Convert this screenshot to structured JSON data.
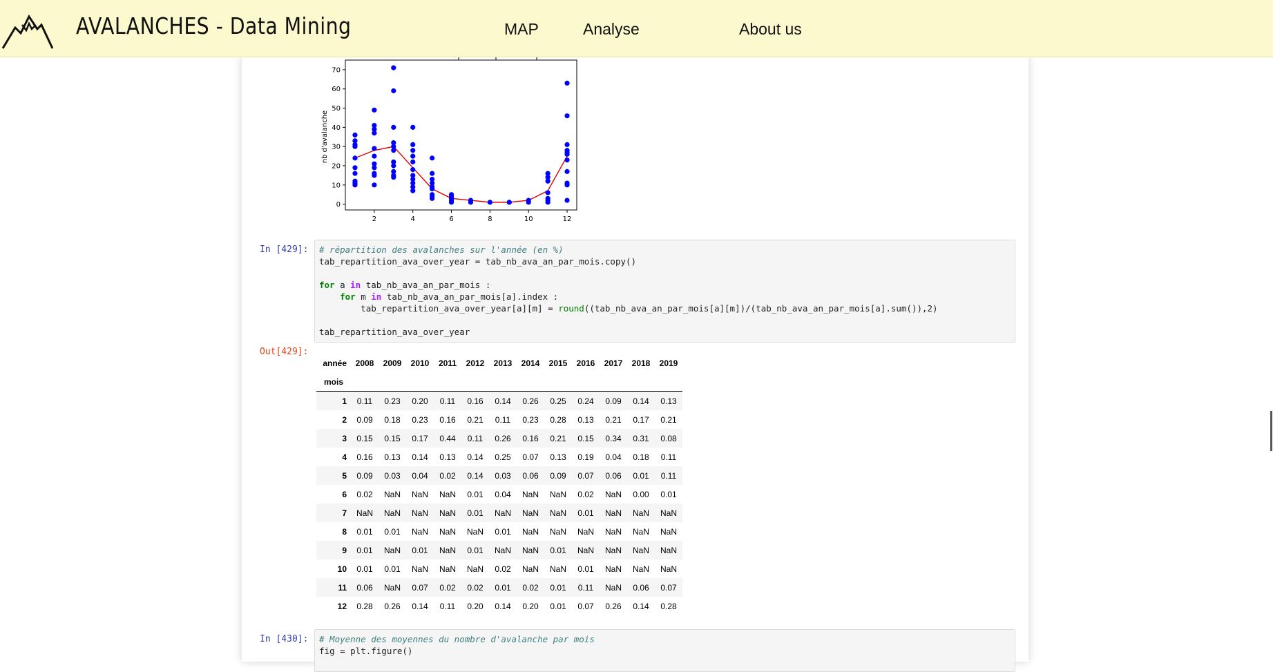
{
  "navbar": {
    "brand": "AVALANCHES - Data Mining",
    "links": [
      "MAP",
      "Analyse",
      "About us"
    ]
  },
  "chart_data": {
    "type": "scatter",
    "ylabel": "nb d'avalanche",
    "xlim": [
      0.5,
      12.5
    ],
    "ylim": [
      -3,
      75
    ],
    "xticks": [
      2,
      4,
      6,
      8,
      10,
      12
    ],
    "yticks": [
      0,
      10,
      20,
      30,
      40,
      50,
      60,
      70
    ],
    "points": [
      [
        1,
        36
      ],
      [
        1,
        33
      ],
      [
        1,
        31
      ],
      [
        1,
        30
      ],
      [
        1,
        24
      ],
      [
        1,
        19
      ],
      [
        1,
        16
      ],
      [
        1,
        12
      ],
      [
        1,
        11
      ],
      [
        1,
        10
      ],
      [
        2,
        49
      ],
      [
        2,
        41
      ],
      [
        2,
        39
      ],
      [
        2,
        37
      ],
      [
        2,
        29
      ],
      [
        2,
        25
      ],
      [
        2,
        21
      ],
      [
        2,
        19
      ],
      [
        2,
        16
      ],
      [
        2,
        15
      ],
      [
        2,
        10
      ],
      [
        3,
        71
      ],
      [
        3,
        59
      ],
      [
        3,
        40
      ],
      [
        3,
        32
      ],
      [
        3,
        30
      ],
      [
        3,
        28
      ],
      [
        3,
        22
      ],
      [
        3,
        20
      ],
      [
        3,
        17
      ],
      [
        3,
        15
      ],
      [
        3,
        14
      ],
      [
        4,
        40
      ],
      [
        4,
        31
      ],
      [
        4,
        28
      ],
      [
        4,
        25
      ],
      [
        4,
        22
      ],
      [
        4,
        18
      ],
      [
        4,
        15
      ],
      [
        4,
        13
      ],
      [
        4,
        11
      ],
      [
        4,
        9
      ],
      [
        4,
        7
      ],
      [
        5,
        24
      ],
      [
        5,
        16
      ],
      [
        5,
        13
      ],
      [
        5,
        11
      ],
      [
        5,
        9
      ],
      [
        5,
        8
      ],
      [
        5,
        5
      ],
      [
        5,
        4
      ],
      [
        5,
        3
      ],
      [
        6,
        5
      ],
      [
        6,
        4
      ],
      [
        6,
        3
      ],
      [
        6,
        2
      ],
      [
        6,
        1
      ],
      [
        7,
        2
      ],
      [
        7,
        1
      ],
      [
        8,
        1
      ],
      [
        9,
        1
      ],
      [
        9,
        1
      ],
      [
        10,
        2
      ],
      [
        10,
        1
      ],
      [
        11,
        16
      ],
      [
        11,
        14
      ],
      [
        11,
        12
      ],
      [
        11,
        6
      ],
      [
        11,
        3
      ],
      [
        11,
        2
      ],
      [
        11,
        1
      ],
      [
        12,
        63
      ],
      [
        12,
        46
      ],
      [
        12,
        31
      ],
      [
        12,
        28
      ],
      [
        12,
        27
      ],
      [
        12,
        26
      ],
      [
        12,
        23
      ],
      [
        12,
        17
      ],
      [
        12,
        11
      ],
      [
        12,
        10
      ],
      [
        12,
        2
      ]
    ],
    "mean_line": {
      "x": [
        1,
        2,
        3,
        4,
        5,
        6,
        7,
        8,
        9,
        10,
        11,
        12
      ],
      "y": [
        24,
        28,
        30,
        19,
        8,
        3,
        2,
        1,
        1,
        2,
        7,
        25
      ]
    },
    "point_color": "#0000ff",
    "line_color": "#e00000"
  },
  "cell_429": {
    "in_prompt": "In [429]:",
    "code": [
      "# répartition des avalanches sur l'année (en %)",
      "tab_repartition_ava_over_year = tab_nb_ava_an_par_mois.copy()",
      "",
      "for a in tab_nb_ava_an_par_mois :",
      "    for m in tab_nb_ava_an_par_mois[a].index :",
      "        tab_repartition_ava_over_year[a][m] = round((tab_nb_ava_an_par_mois[a][m])/(tab_nb_ava_an_par_mois[a].sum()),2)",
      "",
      "tab_repartition_ava_over_year"
    ],
    "out_prompt": "Out[429]:"
  },
  "table": {
    "corner": "année",
    "index_name": "mois",
    "columns": [
      "2008",
      "2009",
      "2010",
      "2011",
      "2012",
      "2013",
      "2014",
      "2015",
      "2016",
      "2017",
      "2018",
      "2019"
    ],
    "rows": [
      {
        "index": "1",
        "values": [
          "0.11",
          "0.23",
          "0.20",
          "0.11",
          "0.16",
          "0.14",
          "0.26",
          "0.25",
          "0.24",
          "0.09",
          "0.14",
          "0.13"
        ]
      },
      {
        "index": "2",
        "values": [
          "0.09",
          "0.18",
          "0.23",
          "0.16",
          "0.21",
          "0.11",
          "0.23",
          "0.28",
          "0.13",
          "0.21",
          "0.17",
          "0.21"
        ]
      },
      {
        "index": "3",
        "values": [
          "0.15",
          "0.15",
          "0.17",
          "0.44",
          "0.11",
          "0.26",
          "0.16",
          "0.21",
          "0.15",
          "0.34",
          "0.31",
          "0.08"
        ]
      },
      {
        "index": "4",
        "values": [
          "0.16",
          "0.13",
          "0.14",
          "0.13",
          "0.14",
          "0.25",
          "0.07",
          "0.13",
          "0.19",
          "0.04",
          "0.18",
          "0.11"
        ]
      },
      {
        "index": "5",
        "values": [
          "0.09",
          "0.03",
          "0.04",
          "0.02",
          "0.14",
          "0.03",
          "0.06",
          "0.09",
          "0.07",
          "0.06",
          "0.01",
          "0.11"
        ]
      },
      {
        "index": "6",
        "values": [
          "0.02",
          "NaN",
          "NaN",
          "NaN",
          "0.01",
          "0.04",
          "NaN",
          "NaN",
          "0.02",
          "NaN",
          "0.00",
          "0.01"
        ]
      },
      {
        "index": "7",
        "values": [
          "NaN",
          "NaN",
          "NaN",
          "NaN",
          "0.01",
          "NaN",
          "NaN",
          "NaN",
          "0.01",
          "NaN",
          "NaN",
          "NaN"
        ]
      },
      {
        "index": "8",
        "values": [
          "0.01",
          "0.01",
          "NaN",
          "NaN",
          "NaN",
          "0.01",
          "NaN",
          "NaN",
          "NaN",
          "NaN",
          "NaN",
          "NaN"
        ]
      },
      {
        "index": "9",
        "values": [
          "0.01",
          "NaN",
          "0.01",
          "NaN",
          "0.01",
          "NaN",
          "NaN",
          "0.01",
          "NaN",
          "NaN",
          "NaN",
          "NaN"
        ]
      },
      {
        "index": "10",
        "values": [
          "0.01",
          "0.01",
          "NaN",
          "NaN",
          "NaN",
          "0.02",
          "NaN",
          "NaN",
          "0.01",
          "NaN",
          "NaN",
          "NaN"
        ]
      },
      {
        "index": "11",
        "values": [
          "0.06",
          "NaN",
          "0.07",
          "0.02",
          "0.02",
          "0.01",
          "0.02",
          "0.01",
          "0.11",
          "NaN",
          "0.06",
          "0.07"
        ]
      },
      {
        "index": "12",
        "values": [
          "0.28",
          "0.26",
          "0.14",
          "0.11",
          "0.20",
          "0.14",
          "0.20",
          "0.01",
          "0.07",
          "0.26",
          "0.14",
          "0.28"
        ]
      }
    ]
  },
  "cell_430": {
    "in_prompt": "In [430]:",
    "code": [
      "# Moyenne des moyennes du nombre d'avalanche par mois",
      "fig = plt.figure()"
    ]
  }
}
